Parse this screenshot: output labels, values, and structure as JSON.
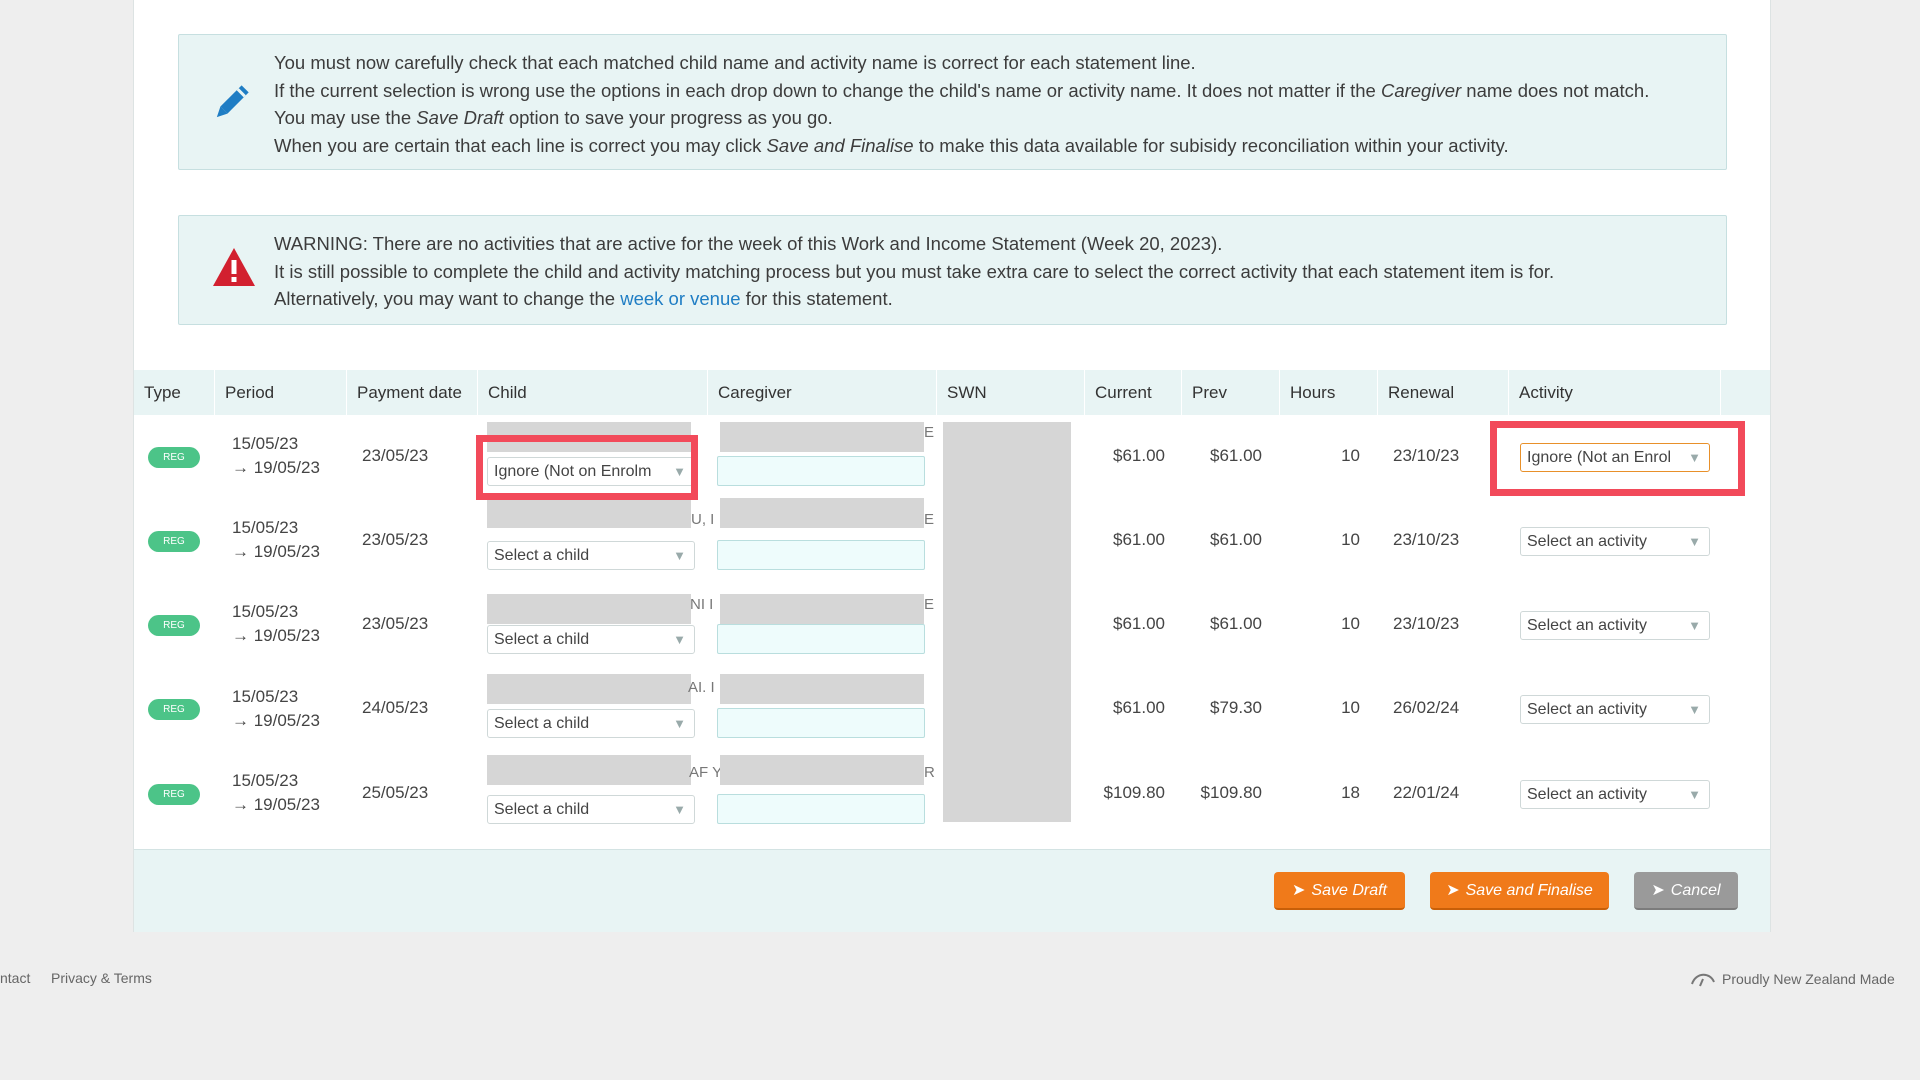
{
  "info_box": {
    "lines": [
      "You must now carefully check that each matched child name and activity name is correct for each statement line.",
      "If the current selection is wrong use the options in each drop down to change the child's name or activity name. It does not matter if the Caregiver name does not match.",
      "You may use the Save Draft option to save your progress as you go.",
      "When you are certain that each line is correct you may click Save and Finalise to make this data available for subisidy reconciliation within your activity."
    ]
  },
  "warning_box": {
    "line1": "WARNING: There are no activities that are active for the week of this Work and Income Statement (Week 20, 2023).",
    "line2": "It is still possible to complete the child and activity matching process but you must take extra care to select the correct activity that each statement item is for.",
    "line3_prefix": "Alternatively, you may want to change the ",
    "line3_link": "week or venue",
    "line3_suffix": " for this statement."
  },
  "table": {
    "headers": {
      "type": "Type",
      "period": "Period",
      "payment_date": "Payment date",
      "child": "Child",
      "caregiver": "Caregiver",
      "swn": "SWN",
      "current": "Current",
      "prev": "Prev",
      "hours": "Hours",
      "renewal": "Renewal",
      "activity": "Activity"
    },
    "rows": [
      {
        "type": "REG",
        "period_start": "15/05/23",
        "period_end": "→ 19/05/23",
        "payment_date": "23/05/23",
        "child_select": "Ignore (Not on Enrolm",
        "child_frag": "",
        "caregiver_frag": "E",
        "current": "$61.00",
        "prev": "$61.00",
        "hours": "10",
        "renewal": "23/10/23",
        "activity_select": "Ignore (Not an Enrol"
      },
      {
        "type": "REG",
        "period_start": "15/05/23",
        "period_end": "→ 19/05/23",
        "payment_date": "23/05/23",
        "child_select": "Select a child",
        "child_frag": "U, I",
        "caregiver_frag": "E",
        "current": "$61.00",
        "prev": "$61.00",
        "hours": "10",
        "renewal": "23/10/23",
        "activity_select": "Select an activity"
      },
      {
        "type": "REG",
        "period_start": "15/05/23",
        "period_end": "→ 19/05/23",
        "payment_date": "23/05/23",
        "child_select": "Select a child",
        "child_frag": "NI I",
        "caregiver_frag": "E",
        "current": "$61.00",
        "prev": "$61.00",
        "hours": "10",
        "renewal": "23/10/23",
        "activity_select": "Select an activity"
      },
      {
        "type": "REG",
        "period_start": "15/05/23",
        "period_end": "→ 19/05/23",
        "payment_date": "24/05/23",
        "child_select": "Select a child",
        "child_frag": "AI. I",
        "caregiver_frag": "",
        "current": "$61.00",
        "prev": "$79.30",
        "hours": "10",
        "renewal": "26/02/24",
        "activity_select": "Select an activity"
      },
      {
        "type": "REG",
        "period_start": "15/05/23",
        "period_end": "→ 19/05/23",
        "payment_date": "25/05/23",
        "child_select": "Select a child",
        "child_frag": "AF Y",
        "caregiver_frag": "R",
        "current": "$109.80",
        "prev": "$109.80",
        "hours": "18",
        "renewal": "22/01/24",
        "activity_select": "Select an activity"
      }
    ]
  },
  "buttons": {
    "save_draft": "Save Draft",
    "save_finalise": "Save and Finalise",
    "cancel": "Cancel"
  },
  "footer": {
    "contact": "ntact",
    "privacy": "Privacy & Terms",
    "made": "Proudly New Zealand Made"
  },
  "colors": {
    "accent_orange": "#f07a1a",
    "badge_green": "#4cc488",
    "warning_red": "#d2202f",
    "info_blue": "#1f7dc4",
    "highlight_red": "#f24a5a"
  },
  "icons": {
    "info": "pencil-icon",
    "warning": "warning-triangle-icon"
  }
}
